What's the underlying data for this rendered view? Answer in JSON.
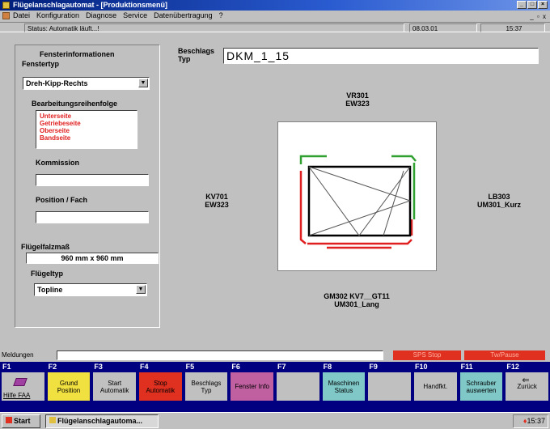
{
  "window": {
    "title": "Flügelanschlagautomat - [Produktionsmenü]"
  },
  "menu": {
    "items": [
      "Datei",
      "Konfiguration",
      "Diagnose",
      "Service",
      "Datenübertragung",
      "?"
    ],
    "mdi_controls": "_ ▫ x"
  },
  "statusline": {
    "label": "Status:",
    "value": "Automatik läuft...!",
    "date": "08.03.01",
    "time": "15:37"
  },
  "left": {
    "section_title": "Fensterinformationen",
    "fenstertyp_label": "Fenstertyp",
    "fenstertyp_value": "Dreh-Kipp-Rechts",
    "bearbeitung_label": "Bearbeitungsreihenfolge",
    "bearbeitung_items": [
      "Unterseite",
      "Getriebeseite",
      "Oberseite",
      "Bandseite"
    ],
    "kommission_label": "Kommission",
    "kommission_value": "",
    "position_label": "Position / Fach",
    "position_value": "",
    "falzmass_label": "Flügelfalzmaß",
    "falzmass_value": "960 mm x 960 mm",
    "fluegeltyp_label": "Flügeltyp",
    "fluegeltyp_value": "Topline"
  },
  "main": {
    "beschlag_label_1": "Beschlags",
    "beschlag_label_2": "Typ",
    "beschlag_value": "DKM_1_15",
    "top_label_1": "VR301",
    "top_label_2": "EW323",
    "left_label_1": "KV701",
    "left_label_2": "EW323",
    "right_label_1": "LB303",
    "right_label_2": "UM301_Kurz",
    "bottom_label_1": "GM302    KV7__GT11",
    "bottom_label_2": "UM301_Lang"
  },
  "messages": {
    "label": "Meldungen",
    "value": "",
    "status1": "SPS Stop",
    "status2": "Tw/Pause"
  },
  "fkeys": [
    {
      "num": "F1",
      "label": "",
      "color": "#000080"
    },
    {
      "num": "F2",
      "label": "Grund Position",
      "color": "#f0e040"
    },
    {
      "num": "F3",
      "label": "Start Automatik",
      "color": "#c0c0c0"
    },
    {
      "num": "F4",
      "label": "Stop Automatik",
      "color": "#e03020"
    },
    {
      "num": "F5",
      "label": "Beschlags Typ",
      "color": "#c0c0c0"
    },
    {
      "num": "F6",
      "label": "Fenster Info",
      "color": "#c060a0"
    },
    {
      "num": "F7",
      "label": "",
      "color": "#c0c0c0"
    },
    {
      "num": "F8",
      "label": "Maschinen Status",
      "color": "#80c8c8"
    },
    {
      "num": "F9",
      "label": "",
      "color": "#c0c0c0"
    },
    {
      "num": "F10",
      "label": "Handfkt.",
      "color": "#c0c0c0"
    },
    {
      "num": "F11",
      "label": "Schrauber auswerten",
      "color": "#80c8c8"
    },
    {
      "num": "F12",
      "label": "Zurück",
      "color": "#c0c0c0"
    }
  ],
  "f1_text": "Hilfe FAA",
  "taskbar": {
    "start": "Start",
    "task": "Flügelanschlagautoma...",
    "clock": "15:37"
  },
  "colors": {
    "titlebar": "#001e7a",
    "fkey_bar": "#000080",
    "red_hardware": "#e02020",
    "green_hardware": "#30a030"
  }
}
